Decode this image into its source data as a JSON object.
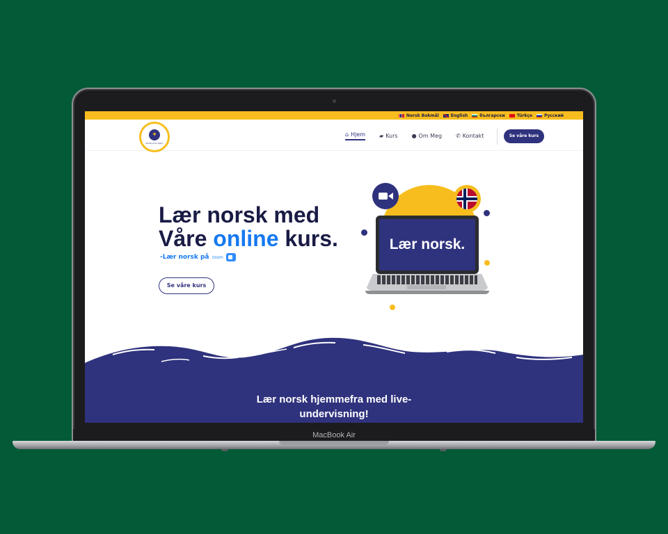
{
  "device": {
    "model_label": "MacBook Air"
  },
  "language_bar": {
    "items": [
      {
        "label": "Norsk Bokmål",
        "flag": "norway-flag"
      },
      {
        "label": "English",
        "flag": "uk-flag"
      },
      {
        "label": "български",
        "flag": "bulgaria-flag"
      },
      {
        "label": "Türkçe",
        "flag": "turkey-flag"
      },
      {
        "label": "Русский",
        "flag": "russia-flag"
      }
    ]
  },
  "header": {
    "logo_text": "Norsk Kurs Hjem",
    "nav": [
      {
        "label": "Hjem",
        "icon": "home-icon"
      },
      {
        "label": "Kurs",
        "icon": "graduation-cap-icon"
      },
      {
        "label": "Om Meg",
        "icon": "user-icon"
      },
      {
        "label": "Kontakt",
        "icon": "phone-icon"
      }
    ],
    "cta_label": "Se våre kurs"
  },
  "hero": {
    "title_line1": "Lær norsk med",
    "title_line2_pre": "Våre ",
    "title_line2_accent": "online",
    "title_line2_post": " kurs.",
    "subtitle": "-Lær norsk på",
    "zoom_word": "zoom",
    "button_label": "Se våre kurs",
    "illustration_screen_text": "Lær norsk."
  },
  "section": {
    "heading_line1": "Lær norsk hjemmefra med live-",
    "heading_line2": "undervisning!"
  },
  "colors": {
    "background": "#035a37",
    "brand_yellow": "#f7bd1e",
    "brand_navy": "#2f327d",
    "accent_blue": "#1679f0"
  }
}
